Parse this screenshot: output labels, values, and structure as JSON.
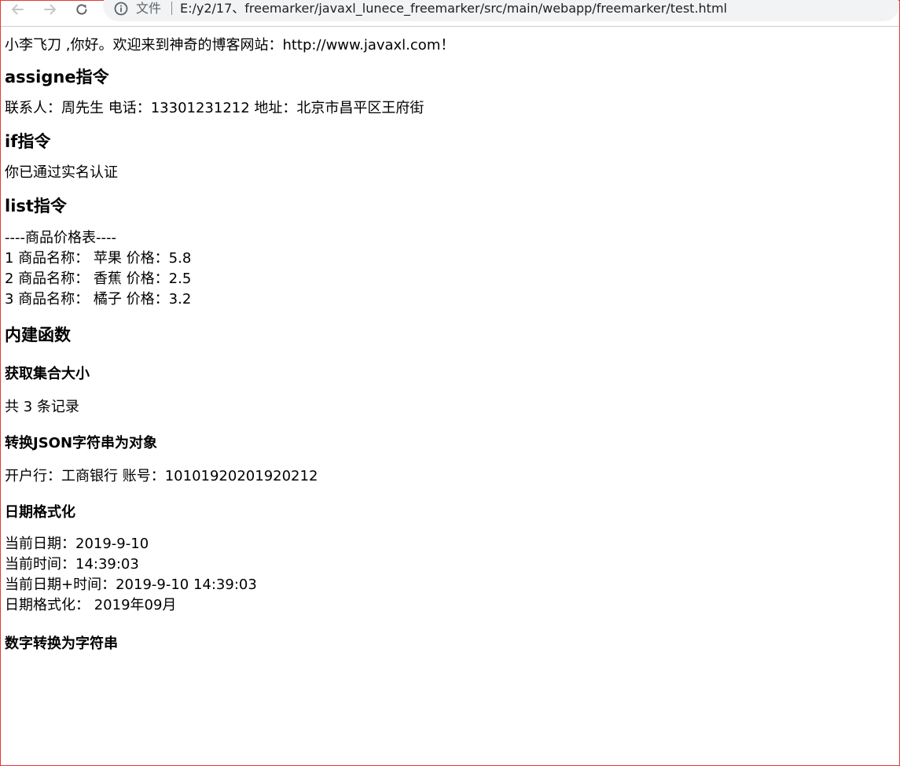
{
  "browser": {
    "scheme_label": "文件",
    "url": "E:/y2/17、freemarker/javaxl_lunece_freemarker/src/main/webapp/freemarker/test.html"
  },
  "page": {
    "greeting": "小李飞刀 ,你好。欢迎来到神奇的博客网站：http://www.javaxl.com！",
    "assign_heading": "assigne指令",
    "contact_line": "联系人：周先生 电话：13301231212 地址：北京市昌平区王府街",
    "if_heading": "if指令",
    "verified_text": "你已通过实名认证",
    "list_heading": "list指令",
    "price_table_title": "----商品价格表----",
    "products": [
      {
        "index": "1",
        "name_label": "商品名称：",
        "name": "苹果",
        "price_label": "价格：",
        "price": "5.8"
      },
      {
        "index": "2",
        "name_label": "商品名称：",
        "name": "香蕉",
        "price_label": "价格：",
        "price": "2.5"
      },
      {
        "index": "3",
        "name_label": "商品名称：",
        "name": "橘子",
        "price_label": "价格：",
        "price": "3.2"
      }
    ],
    "builtins_heading": "内建函数",
    "size_subheading": "获取集合大小",
    "size_text": "共 3 条记录",
    "json_subheading": "转换JSON字符串为对象",
    "bank_line": "开户行：工商银行 账号：10101920201920212",
    "date_subheading": "日期格式化",
    "current_date": "当前日期：2019-9-10",
    "current_time": "当前时间：14:39:03",
    "current_datetime": "当前日期+时间：2019-9-10 14:39:03",
    "formatted_date": "日期格式化： 2019年09月",
    "number_subheading": "数字转换为字符串"
  }
}
